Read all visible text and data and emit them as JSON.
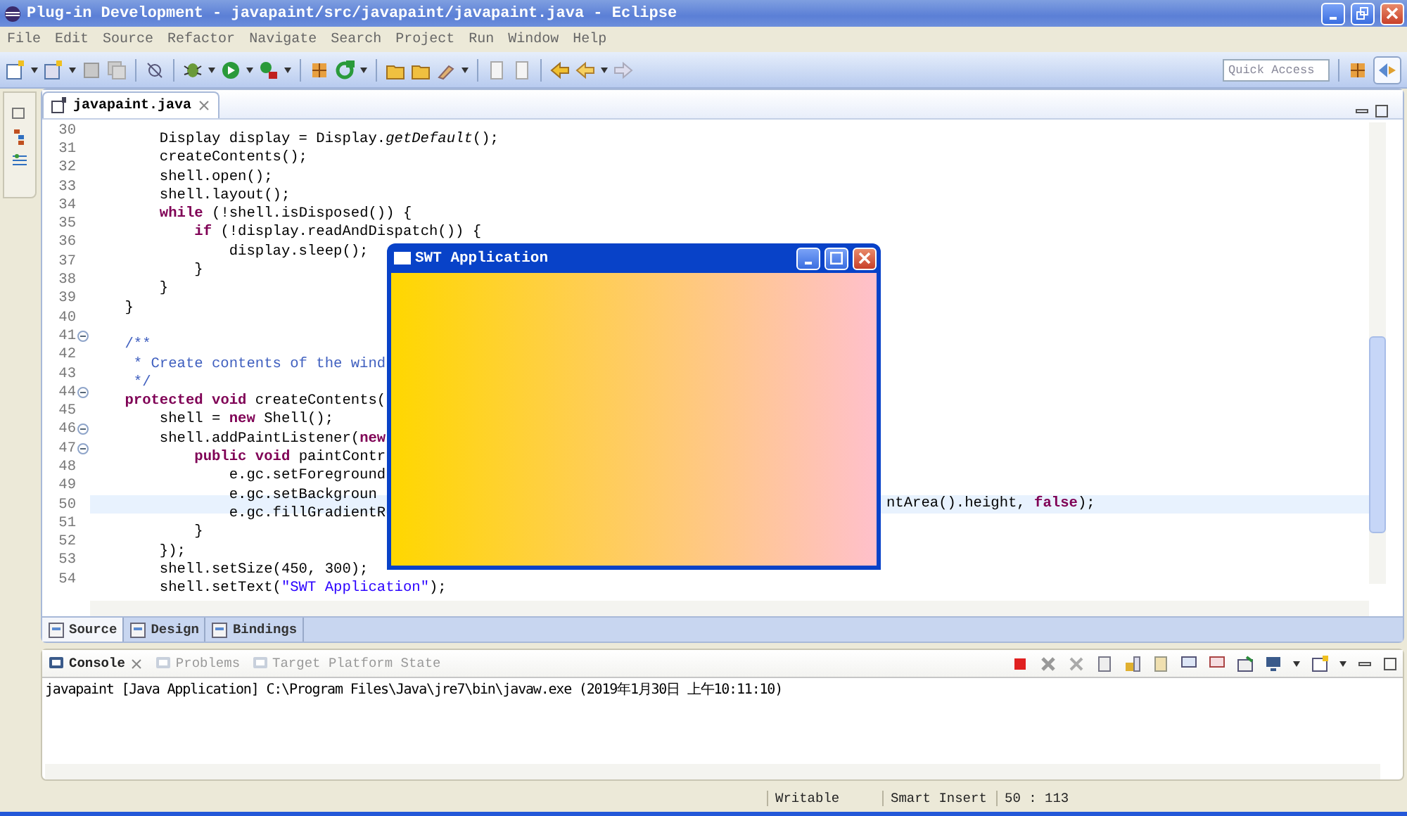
{
  "window": {
    "title": "Plug-in Development - javapaint/src/javapaint/javapaint.java - Eclipse"
  },
  "menu": [
    "File",
    "Edit",
    "Source",
    "Refactor",
    "Navigate",
    "Search",
    "Project",
    "Run",
    "Window",
    "Help"
  ],
  "quick_access": {
    "placeholder": "Quick Access"
  },
  "editor": {
    "tabs": [
      {
        "label": "javapaint.java",
        "selected": true
      }
    ],
    "lines": [
      {
        "number": "30",
        "foldable": false,
        "current": false,
        "tokens": [
          {
            "kind": "plain",
            "text": "        Display display = Display."
          },
          {
            "kind": "italic",
            "text": "getDefault"
          },
          {
            "kind": "plain",
            "text": "();"
          }
        ]
      },
      {
        "number": "31",
        "foldable": false,
        "current": false,
        "tokens": [
          {
            "kind": "plain",
            "text": "        createContents();"
          }
        ]
      },
      {
        "number": "32",
        "foldable": false,
        "current": false,
        "tokens": [
          {
            "kind": "plain",
            "text": "        shell.open();"
          }
        ]
      },
      {
        "number": "33",
        "foldable": false,
        "current": false,
        "tokens": [
          {
            "kind": "plain",
            "text": "        shell.layout();"
          }
        ]
      },
      {
        "number": "34",
        "foldable": false,
        "current": false,
        "tokens": [
          {
            "kind": "keyword",
            "text": "        while"
          },
          {
            "kind": "plain",
            "text": " (!shell.isDisposed()) {"
          }
        ]
      },
      {
        "number": "35",
        "foldable": false,
        "current": false,
        "tokens": [
          {
            "kind": "keyword",
            "text": "            if"
          },
          {
            "kind": "plain",
            "text": " (!display.readAndDispatch()) {"
          }
        ]
      },
      {
        "number": "36",
        "foldable": false,
        "current": false,
        "tokens": [
          {
            "kind": "plain",
            "text": "                display.sleep();"
          }
        ]
      },
      {
        "number": "37",
        "foldable": false,
        "current": false,
        "tokens": [
          {
            "kind": "plain",
            "text": "            }"
          }
        ]
      },
      {
        "number": "38",
        "foldable": false,
        "current": false,
        "tokens": [
          {
            "kind": "plain",
            "text": "        }"
          }
        ]
      },
      {
        "number": "39",
        "foldable": false,
        "current": false,
        "tokens": [
          {
            "kind": "plain",
            "text": "    }"
          }
        ]
      },
      {
        "number": "40",
        "foldable": false,
        "current": false
      },
      {
        "number": "41",
        "foldable": true,
        "current": false,
        "tokens": [
          {
            "kind": "comment",
            "text": "    /**"
          }
        ]
      },
      {
        "number": "42",
        "foldable": false,
        "current": false,
        "tokens": [
          {
            "kind": "comment",
            "text": "     * Create contents of the wind"
          }
        ]
      },
      {
        "number": "43",
        "foldable": false,
        "current": false,
        "tokens": [
          {
            "kind": "comment",
            "text": "     */"
          }
        ]
      },
      {
        "number": "44",
        "foldable": true,
        "current": false,
        "tokens": [
          {
            "kind": "keyword",
            "text": "    protected"
          },
          {
            "kind": "keyword",
            "text": " void"
          },
          {
            "kind": "plain",
            "text": " createContents("
          }
        ]
      },
      {
        "number": "45",
        "foldable": false,
        "current": false,
        "tokens": [
          {
            "kind": "plain",
            "text": "        shell = "
          },
          {
            "kind": "keyword",
            "text": "new"
          },
          {
            "kind": "plain",
            "text": " Shell();"
          }
        ]
      },
      {
        "number": "46",
        "foldable": true,
        "current": false,
        "tokens": [
          {
            "kind": "plain",
            "text": "        shell.addPaintListener("
          },
          {
            "kind": "keyword",
            "text": "new"
          }
        ]
      },
      {
        "number": "47",
        "foldable": true,
        "current": false,
        "tokens": [
          {
            "kind": "keyword",
            "text": "            public"
          },
          {
            "kind": "keyword",
            "text": " void"
          },
          {
            "kind": "plain",
            "text": " paintContr"
          }
        ]
      },
      {
        "number": "48",
        "foldable": false,
        "current": false,
        "tokens": [
          {
            "kind": "plain",
            "text": "                e.gc.setForeground"
          }
        ]
      },
      {
        "number": "49",
        "foldable": false,
        "current": false,
        "tokens": [
          {
            "kind": "plain",
            "text": "                e.gc.setBackgroun"
          }
        ]
      },
      {
        "number": "50",
        "foldable": false,
        "current": true,
        "tokens": [
          {
            "kind": "plain",
            "text": "                e.gc.fillGradientR"
          }
        ],
        "after": [
          {
            "kind": "plain",
            "text": "ntArea().height, "
          },
          {
            "kind": "keyword",
            "text": "false"
          },
          {
            "kind": "plain",
            "text": ");"
          }
        ]
      },
      {
        "number": "51",
        "foldable": false,
        "current": false,
        "tokens": [
          {
            "kind": "plain",
            "text": "            }"
          }
        ]
      },
      {
        "number": "52",
        "foldable": false,
        "current": false,
        "tokens": [
          {
            "kind": "plain",
            "text": "        });"
          }
        ]
      },
      {
        "number": "53",
        "foldable": false,
        "current": false,
        "tokens": [
          {
            "kind": "plain",
            "text": "        shell.setSize(450, 300);"
          }
        ]
      },
      {
        "number": "54",
        "foldable": false,
        "current": false,
        "tokens": [
          {
            "kind": "plain",
            "text": "        shell.setText("
          },
          {
            "kind": "string",
            "text": "\"SWT Application\""
          },
          {
            "kind": "plain",
            "text": ");"
          }
        ]
      }
    ],
    "bottom_tabs": [
      {
        "label": "Source",
        "selected": true
      },
      {
        "label": "Design",
        "selected": false
      },
      {
        "label": "Bindings",
        "selected": false
      }
    ]
  },
  "console": {
    "tabs": [
      {
        "label": "Console",
        "selected": true
      },
      {
        "label": "Problems",
        "selected": false
      },
      {
        "label": "Target Platform State",
        "selected": false
      }
    ],
    "text": "javapaint [Java Application] C:\\Program Files\\Java\\jre7\\bin\\javaw.exe (2019年1月30日 上午10:11:10)"
  },
  "status_bar": [
    "Writable",
    "Smart Insert",
    "50 : 113"
  ],
  "app_window": {
    "title": "SWT Application"
  }
}
